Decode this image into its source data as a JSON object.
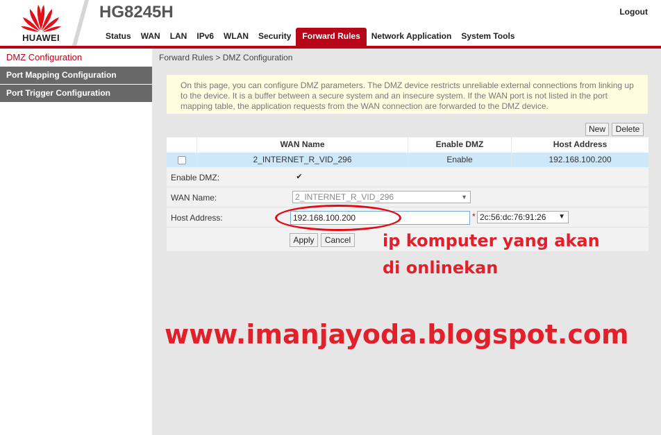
{
  "header": {
    "brand": "HUAWEI",
    "model": "HG8245H",
    "logout_label": "Logout",
    "brand_color": "#b7061a"
  },
  "menu": [
    {
      "label": "Status",
      "active": false
    },
    {
      "label": "WAN",
      "active": false
    },
    {
      "label": "LAN",
      "active": false
    },
    {
      "label": "IPv6",
      "active": false
    },
    {
      "label": "WLAN",
      "active": false
    },
    {
      "label": "Security",
      "active": false
    },
    {
      "label": "Forward Rules",
      "active": true
    },
    {
      "label": "Network Application",
      "active": false
    },
    {
      "label": "System Tools",
      "active": false
    }
  ],
  "sidebar": {
    "items": [
      {
        "label": "DMZ Configuration",
        "active": true
      },
      {
        "label": "Port Mapping Configuration",
        "active": false
      },
      {
        "label": "Port Trigger Configuration",
        "active": false
      }
    ]
  },
  "content": {
    "breadcrumb": "Forward Rules > DMZ Configuration",
    "note": "On this page, you can configure DMZ parameters. The DMZ device restricts unreliable external connections from linking up to the device. It is a buffer between a secure system and an insecure system. If the WAN port is not listed in the port mapping table, the application requests from the WAN connection are forwarded to the DMZ device.",
    "new_label": "New",
    "delete_label": "Delete",
    "table": {
      "columns": [
        "",
        "WAN Name",
        "Enable DMZ",
        "Host Address"
      ],
      "rows": [
        {
          "checked": false,
          "wan_name": "2_INTERNET_R_VID_296",
          "enable_dmz": "Enable",
          "host_address": "192.168.100.200"
        }
      ]
    },
    "form": {
      "enable_dmz_label": "Enable DMZ:",
      "enable_dmz_checked": true,
      "wan_name_label": "WAN Name:",
      "wan_name_value": "2_INTERNET_R_VID_296",
      "host_address_label": "Host Address:",
      "host_address_value": "192.168.100.200",
      "required_mark": "*",
      "mac_select_value": "2c:56:dc:76:91:26",
      "apply_label": "Apply",
      "cancel_label": "Cancel"
    }
  },
  "annotation": {
    "line1": "ip komputer yang akan",
    "line2": "di onlinekan",
    "watermark": "www.imanjayoda.blogspot.com",
    "color": "#e0202a"
  }
}
